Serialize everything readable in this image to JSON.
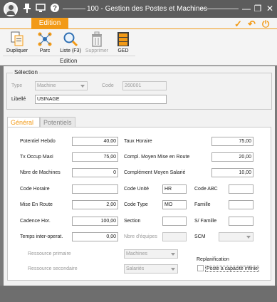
{
  "window": {
    "title": "100 - Gestion des Postes et Machines",
    "controls": {
      "minimize": "—",
      "restore": "❐",
      "close": "✕"
    }
  },
  "ribbon": {
    "tab": "Edition",
    "group": "Edition",
    "buttons": [
      {
        "label": "Dupliquer",
        "icon": "duplicate-icon",
        "disabled": false
      },
      {
        "label": "Parc",
        "icon": "parc-icon",
        "disabled": false
      },
      {
        "label": "Liste (F3)",
        "icon": "search-list-icon",
        "disabled": false
      },
      {
        "label": "Supprimer",
        "icon": "trash-icon",
        "disabled": true
      },
      {
        "label": "GED",
        "icon": "ged-icon",
        "disabled": false
      }
    ],
    "actions": {
      "validate": "✓",
      "undo": "↶",
      "power": "⏻"
    }
  },
  "selection": {
    "legend": "Sélection",
    "type_label": "Type",
    "type_value": "Machine",
    "code_label": "Code",
    "code_value": "260001",
    "libelle_label": "Libellé",
    "libelle_value": "USINAGE"
  },
  "tabs": {
    "general": "Général",
    "potentiels": "Potentiels"
  },
  "form": {
    "potentiel_hebdo": {
      "label": "Potentiel Hebdo",
      "value": "40,00"
    },
    "tx_occup_maxi": {
      "label": "Tx Occup Maxi",
      "value": "75,00"
    },
    "nbre_machines": {
      "label": "Nbre de Machines",
      "value": "0"
    },
    "code_horaire": {
      "label": "Code Horaire",
      "value": ""
    },
    "mise_en_route": {
      "label": "Mise En Route",
      "value": "2,00"
    },
    "cadence_hor": {
      "label": "Cadence Hor.",
      "value": "100,00"
    },
    "temps_inter": {
      "label": "Temps inter-operat.",
      "value": "0,00"
    },
    "taux_horaire": {
      "label": "Taux Horaire",
      "value": "75,00"
    },
    "compl_moyen_mise": {
      "label": "Compl. Moyen Mise en Route",
      "value": "20,00"
    },
    "complement_moyen_salarie": {
      "label": "Complément Moyen Salarié",
      "value": "10,00"
    },
    "code_unite": {
      "label": "Code Unité",
      "value": "HR"
    },
    "code_type": {
      "label": "Code Type",
      "value": "MO"
    },
    "section": {
      "label": "Section",
      "value": ""
    },
    "nbre_equipes": {
      "label": "Nbre d'équipes",
      "value": ""
    },
    "code_abc": {
      "label": "Code ABC",
      "value": ""
    },
    "famille": {
      "label": "Famille",
      "value": ""
    },
    "s_famille": {
      "label": "S/ Famille",
      "value": ""
    },
    "scm": {
      "label": "SCM",
      "value": ""
    },
    "ressource_primaire": {
      "label": "Ressource primaire",
      "value": "Machines"
    },
    "ressource_secondaire": {
      "label": "Ressource secondaire",
      "value": "Salariés"
    },
    "replanification": {
      "label": "Replanification",
      "checkbox_label": "Poste à capacité infinie",
      "checked": false
    }
  }
}
